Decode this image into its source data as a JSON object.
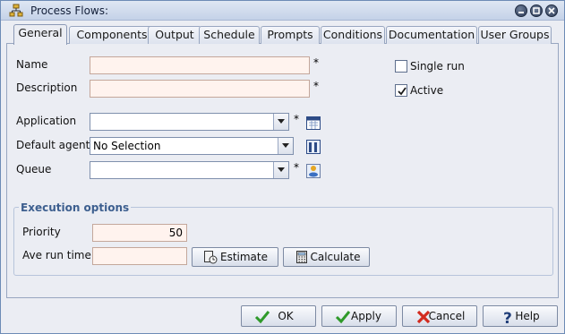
{
  "window": {
    "title": "Process Flows:"
  },
  "tabs": [
    {
      "label": "General",
      "active": true
    },
    {
      "label": "Components"
    },
    {
      "label": "Output"
    },
    {
      "label": "Schedule"
    },
    {
      "label": "Prompts"
    },
    {
      "label": "Conditions"
    },
    {
      "label": "Documentation"
    },
    {
      "label": "User Groups"
    }
  ],
  "general": {
    "name_label": "Name",
    "name_value": "",
    "description_label": "Description",
    "description_value": "",
    "required_mark": "*",
    "single_run_label": "Single run",
    "single_run_checked": false,
    "active_label": "Active",
    "active_checked": true,
    "application_label": "Application",
    "application_value": "",
    "default_agent_label": "Default agent",
    "default_agent_value": "No Selection",
    "queue_label": "Queue",
    "queue_value": ""
  },
  "execution": {
    "title": "Execution options",
    "priority_label": "Priority",
    "priority_value": "50",
    "ave_run_time_label": "Ave run time",
    "ave_run_time_value": "",
    "estimate_label": "Estimate",
    "calculate_label": "Calculate"
  },
  "footer": {
    "ok_label": "OK",
    "apply_label": "Apply",
    "cancel_label": "Cancel",
    "help_label": "Help"
  },
  "colors": {
    "required_field_bg": "#fff3ee",
    "group_title": "#3d5f8f",
    "accent": "#6d8bb6"
  }
}
